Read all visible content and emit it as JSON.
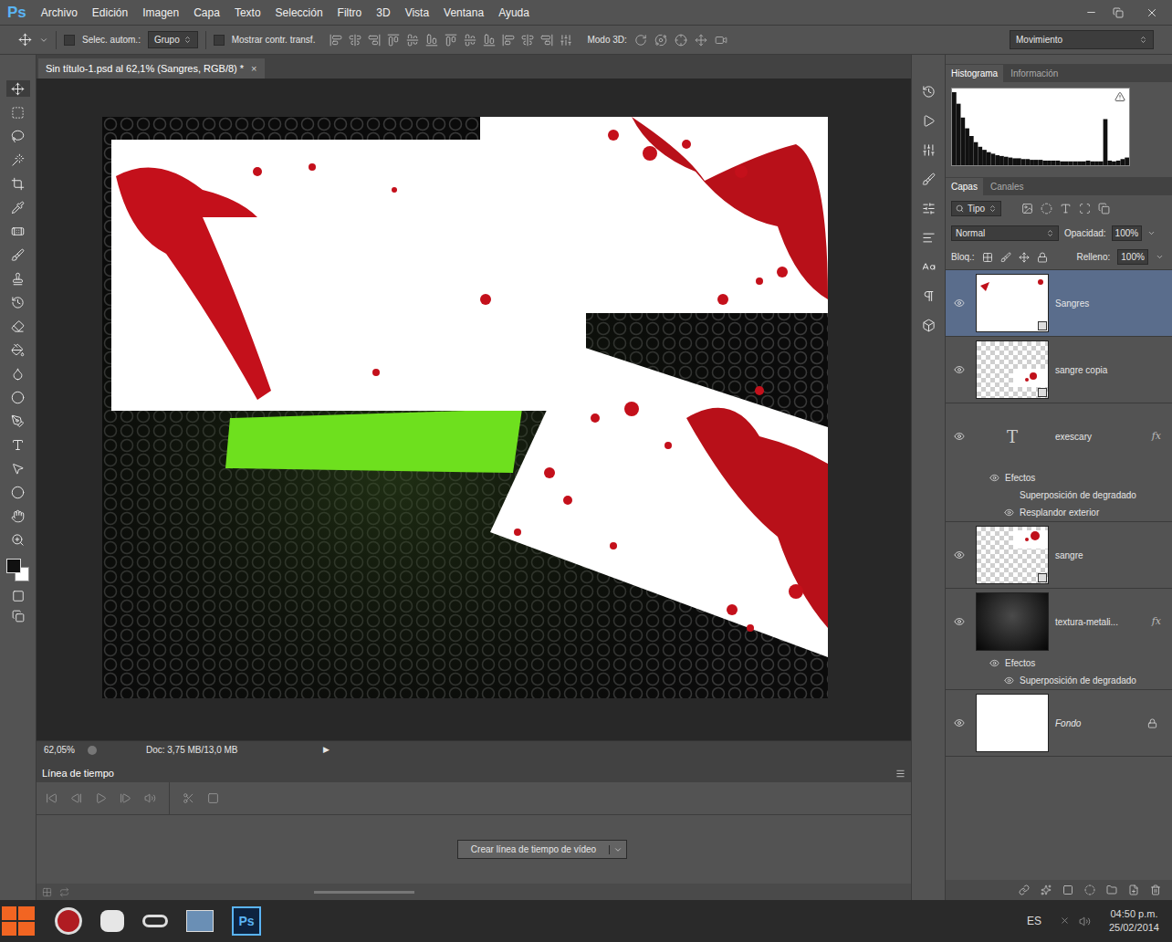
{
  "app": {
    "logo": "Ps"
  },
  "menu": [
    "Archivo",
    "Edición",
    "Imagen",
    "Capa",
    "Texto",
    "Selección",
    "Filtro",
    "3D",
    "Vista",
    "Ventana",
    "Ayuda"
  ],
  "options_bar": {
    "auto_select": {
      "label": "Selec. autom.:",
      "checked": false
    },
    "auto_select_target": "Grupo",
    "show_transform": {
      "label": "Mostrar contr. transf.",
      "checked": false
    },
    "mode_3d_label": "Modo 3D:",
    "workspace": "Movimiento"
  },
  "document_tab": {
    "title": "Sin título-1.psd al 62,1% (Sangres, RGB/8) *",
    "close": "×"
  },
  "status_bar": {
    "zoom": "62,05%",
    "doc_info": "Doc: 3,75 MB/13,0 MB",
    "arrow": "▶"
  },
  "timeline": {
    "title": "Línea de tiempo",
    "create_button": "Crear línea de tiempo de vídeo"
  },
  "histogram_panel": {
    "tabs": [
      {
        "label": "Histograma",
        "selected": true
      },
      {
        "label": "Información",
        "selected": false
      }
    ],
    "values": [
      95,
      80,
      62,
      48,
      38,
      30,
      24,
      20,
      17,
      15,
      13,
      12,
      11,
      10,
      9,
      9,
      8,
      8,
      7,
      7,
      7,
      6,
      6,
      6,
      6,
      5,
      5,
      5,
      5,
      5,
      5,
      6,
      5,
      5,
      5,
      60,
      6,
      5,
      6,
      8,
      10
    ]
  },
  "layers_panel": {
    "tabs": [
      {
        "label": "Capas",
        "selected": true
      },
      {
        "label": "Canales",
        "selected": false
      }
    ],
    "filter": "Tipo",
    "blend_mode": "Normal",
    "opacity_label": "Opacidad:",
    "opacity": "100%",
    "lock_label": "Bloq.:",
    "fill_label": "Relleno:",
    "fill": "100%",
    "layers": [
      {
        "name": "Sangres",
        "kind": "raster",
        "thumb": "white-splat",
        "selected": true,
        "visible": true,
        "italic": false,
        "fx": null,
        "effects": []
      },
      {
        "name": "sangre copia",
        "kind": "raster",
        "thumb": "checker-splat",
        "selected": false,
        "visible": true,
        "italic": false,
        "fx": null,
        "effects": []
      },
      {
        "name": "exescary",
        "kind": "text",
        "glyph": "T",
        "thumb": "text",
        "selected": false,
        "visible": true,
        "italic": false,
        "fx": "fx",
        "effects_label": "Efectos",
        "effects": [
          {
            "label": "Superposición de degradado",
            "visible": false
          },
          {
            "label": "Resplandor exterior",
            "visible": true
          }
        ]
      },
      {
        "name": "sangre",
        "kind": "raster",
        "thumb": "checker-splat-top",
        "selected": false,
        "visible": true,
        "italic": false,
        "fx": null,
        "effects": []
      },
      {
        "name": "textura-metali...",
        "kind": "raster",
        "thumb": "texture",
        "selected": false,
        "visible": true,
        "italic": false,
        "fx": "fx",
        "effects_label": "Efectos",
        "effects": [
          {
            "label": "Superposición de degradado",
            "visible": true
          }
        ]
      },
      {
        "name": "Fondo",
        "kind": "background",
        "thumb": "white",
        "selected": false,
        "visible": true,
        "italic": true,
        "locked": true,
        "fx": null,
        "effects": []
      }
    ]
  },
  "taskbar": {
    "ps_label": "Ps",
    "language": "ES",
    "time": "04:50 p.m.",
    "date": "25/02/2014"
  }
}
